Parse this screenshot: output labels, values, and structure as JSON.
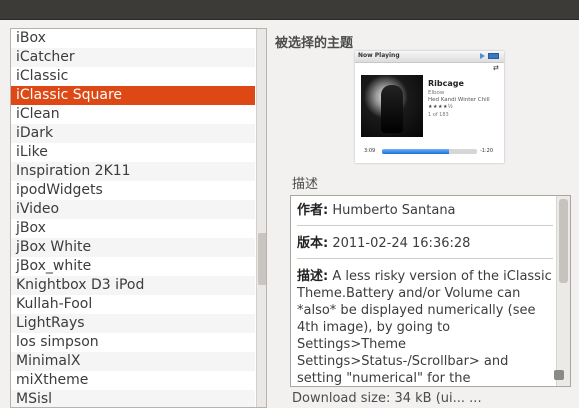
{
  "theme_list": {
    "items": [
      "iBox",
      "iCatcher",
      "iClassic",
      "iClassic Square",
      "iClean",
      "iDark",
      "iLike",
      "Inspiration 2K11",
      "ipodWidgets",
      "iVideo",
      "jBox",
      "jBox White",
      "jBox_white",
      "Knightbox D3 iPod",
      "Kullah-Fool",
      "LightRays",
      "los simpson",
      "MinimalX",
      "miXtheme",
      "MSisl"
    ],
    "selected_index": 3,
    "selected_color": "#dd4814"
  },
  "preview": {
    "heading": "被选择的主题",
    "now_playing": {
      "header": "Now Playing",
      "title": "Ribcage",
      "artist": "Elbow",
      "album": "Hed Kandi Winter Chill",
      "rating": "★★★★½",
      "index": "1 of 183",
      "time_elapsed": "3:09",
      "time_remaining": "-1:20",
      "progress": 0.7
    }
  },
  "description": {
    "heading": "描述",
    "author_label": "作者:",
    "author_value": " Humberto Santana",
    "version_label": "版本:",
    "version_value": " 2011-02-24 16:36:28",
    "desc_label": "描述:",
    "desc_value": " A less risky version of the iClassic Theme.Battery and/or Volume can *also* be displayed numerically (see 4th image), by going to Settings>Theme Settings>Status-/Scrollbar> and setting \"numerical\" for the"
  },
  "bottom": {
    "text": "Download size: 34 kB (ui... ..."
  },
  "icons": {
    "play": "play-icon",
    "battery": "battery-icon",
    "repeat": "repeat-icon",
    "resize": "resize-grip-icon"
  }
}
